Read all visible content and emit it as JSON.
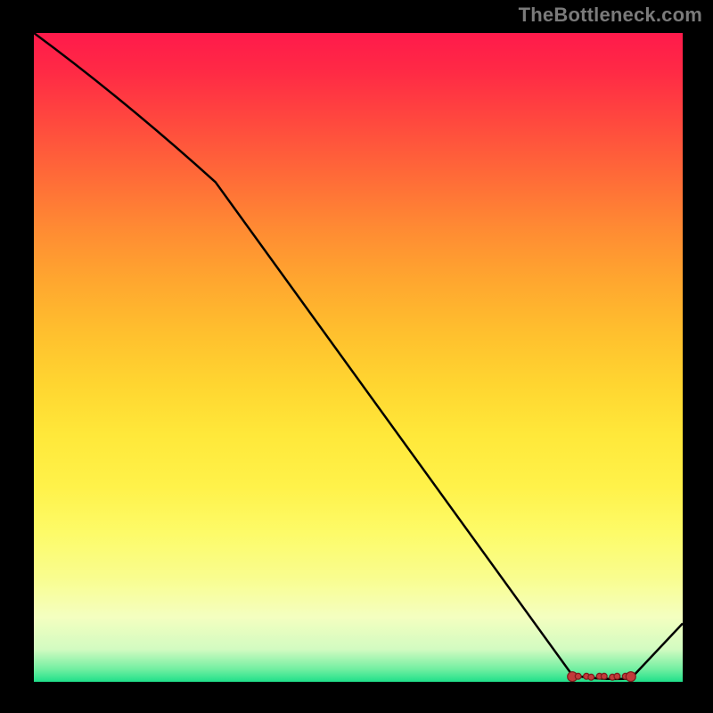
{
  "attribution": "TheBottleneck.com",
  "chart_data": {
    "type": "line",
    "title": "",
    "xlabel": "",
    "ylabel": "",
    "xlim": [
      0,
      100
    ],
    "ylim": [
      0,
      100
    ],
    "series": [
      {
        "name": "curve",
        "points": [
          {
            "x": 0,
            "y": 100
          },
          {
            "x": 28,
            "y": 77
          },
          {
            "x": 83,
            "y": 1
          },
          {
            "x": 92,
            "y": 0.5
          },
          {
            "x": 100,
            "y": 9
          }
        ]
      }
    ],
    "markers": {
      "name": "highlight-range",
      "y": 0.8,
      "x_start": 83,
      "x_end": 92,
      "count": 10
    }
  },
  "colors": {
    "gradient_top": "#ff1a4b",
    "gradient_bottom": "#1fe08a",
    "curve": "#000000",
    "marker": "#c23a3a"
  }
}
